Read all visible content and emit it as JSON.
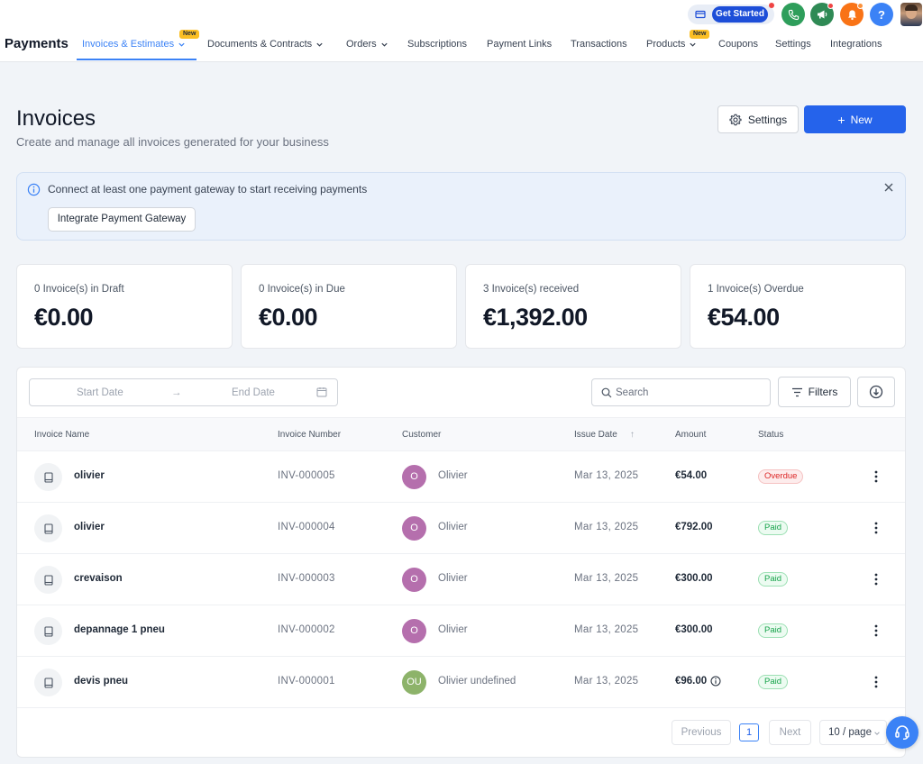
{
  "topbar": {
    "get_started_label": "Get Started",
    "icons": [
      "card-icon",
      "phone-icon",
      "megaphone-icon",
      "bell-icon",
      "help-icon"
    ],
    "help_glyph": "?",
    "colors": {
      "phone": "#2e9e5b",
      "megaphone": "#2f8a55",
      "bell": "#f97316",
      "help": "#3b82f6"
    }
  },
  "nav": {
    "brand": "Payments",
    "items": [
      {
        "label": "Invoices & Estimates",
        "active": true,
        "dropdown": true,
        "badge": "New"
      },
      {
        "label": "Documents & Contracts",
        "dropdown": true
      },
      {
        "label": "Orders",
        "dropdown": true
      },
      {
        "label": "Subscriptions"
      },
      {
        "label": "Payment Links"
      },
      {
        "label": "Transactions"
      },
      {
        "label": "Products",
        "dropdown": true,
        "badge": "New"
      },
      {
        "label": "Coupons"
      },
      {
        "label": "Settings"
      },
      {
        "label": "Integrations"
      }
    ]
  },
  "header": {
    "title": "Invoices",
    "subtitle": "Create and manage all invoices generated for your business",
    "settings_label": "Settings",
    "new_label": "New",
    "new_glyph": "+"
  },
  "banner": {
    "message": "Connect at least one payment gateway to start receiving payments",
    "button_label": "Integrate Payment Gateway"
  },
  "stats": [
    {
      "label": "0 Invoice(s) in Draft",
      "value": "€0.00"
    },
    {
      "label": "0 Invoice(s) in Due",
      "value": "€0.00"
    },
    {
      "label": "3 Invoice(s) received",
      "value": "€1,392.00"
    },
    {
      "label": "1 Invoice(s) Overdue",
      "value": "€54.00"
    }
  ],
  "toolbar": {
    "start_date_placeholder": "Start Date",
    "range_arrow": "→",
    "end_date_placeholder": "End Date",
    "search_placeholder": "Search",
    "filters_label": "Filters"
  },
  "table": {
    "columns": [
      "Invoice Name",
      "Invoice Number",
      "Customer",
      "Issue Date",
      "Amount",
      "Status"
    ],
    "sort_arrow": "↑",
    "rows": [
      {
        "name": "olivier",
        "number": "INV-000005",
        "customer_initials": "O",
        "customer": "Olivier",
        "date": "Mar 13, 2025",
        "amount": "€54.00",
        "status": "Overdue",
        "avatar_color": "#b56fad"
      },
      {
        "name": "olivier",
        "number": "INV-000004",
        "customer_initials": "O",
        "customer": "Olivier",
        "date": "Mar 13, 2025",
        "amount": "€792.00",
        "status": "Paid",
        "avatar_color": "#b56fad"
      },
      {
        "name": "crevaison",
        "number": "INV-000003",
        "customer_initials": "O",
        "customer": "Olivier",
        "date": "Mar 13, 2025",
        "amount": "€300.00",
        "status": "Paid",
        "avatar_color": "#b56fad"
      },
      {
        "name": "depannage 1 pneu",
        "number": "INV-000002",
        "customer_initials": "O",
        "customer": "Olivier",
        "date": "Mar 13, 2025",
        "amount": "€300.00",
        "status": "Paid",
        "avatar_color": "#b56fad"
      },
      {
        "name": "devis pneu",
        "number": "INV-000001",
        "customer_initials": "OU",
        "customer": "Olivier undefined",
        "date": "Mar 13, 2025",
        "amount": "€96.00",
        "status": "Paid",
        "avatar_color": "#8db36a",
        "amount_info": true
      }
    ]
  },
  "pagination": {
    "previous_label": "Previous",
    "current_page": "1",
    "next_label": "Next",
    "page_size_label": "10 / page"
  },
  "colors": {
    "primary": "#2563eb",
    "overdue": "#dc2626",
    "paid": "#16a34a"
  }
}
